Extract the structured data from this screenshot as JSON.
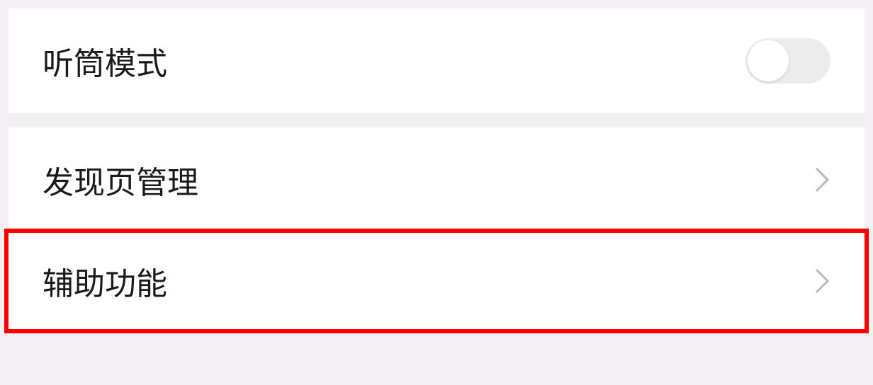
{
  "settings": {
    "earpiece_mode": {
      "label": "听筒模式",
      "enabled": false
    },
    "discover_page": {
      "label": "发现页管理"
    },
    "accessibility": {
      "label": "辅助功能"
    }
  }
}
